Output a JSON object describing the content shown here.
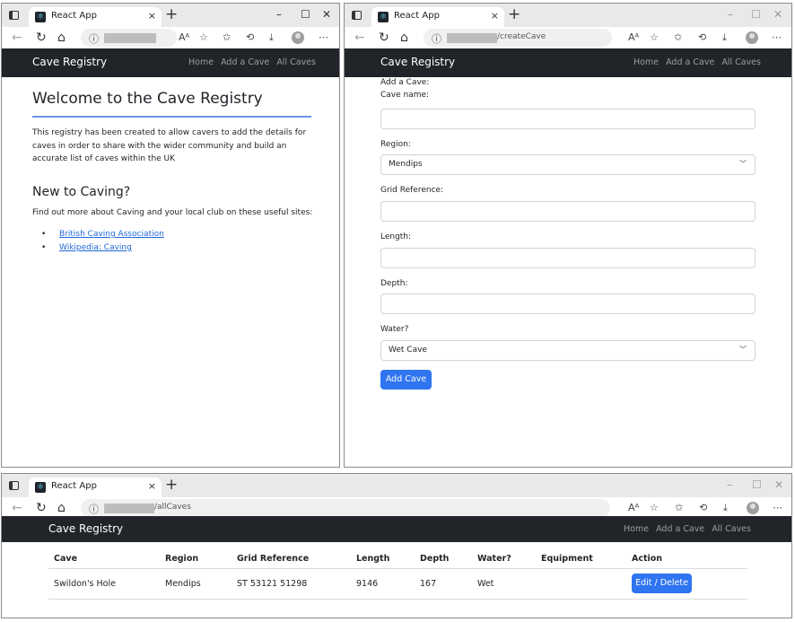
{
  "colors": {
    "navbar": "#212529",
    "primary": "#2f74f0",
    "link": "#1e67d8",
    "accent_rule": "#6b94e8"
  },
  "browser": {
    "tab_title": "React App",
    "tab_close": "×",
    "new_tab": "+",
    "window_controls": [
      "–",
      "☐",
      "✕"
    ],
    "read_aloud": "Aᴬ"
  },
  "windows": {
    "home": {
      "url_path": ""
    },
    "create": {
      "url_path": "/createCave"
    },
    "all": {
      "url_path": "/allCaves"
    }
  },
  "navbar": {
    "brand": "Cave Registry",
    "links": [
      "Home",
      "Add a Cave",
      "All Caves"
    ]
  },
  "home_page": {
    "title": "Welcome to the Cave Registry",
    "intro": "This registry has been created to allow cavers to add the details for caves in order to share with the wider community and build an accurate list of caves within the UK",
    "new_heading": "New to Caving?",
    "new_text": "Find out more about Caving and your local club on these useful sites:",
    "links": [
      "British Caving Association",
      "Wikipedia: Caving"
    ]
  },
  "create_page": {
    "form_title": "Add a Cave:",
    "cave_name_label": "Cave name:",
    "region_label": "Region:",
    "region_value": "Mendips",
    "grid_label": "Grid Reference:",
    "length_label": "Length:",
    "depth_label": "Depth:",
    "water_label": "Water?",
    "water_value": "Wet Cave",
    "submit": "Add Cave"
  },
  "all_page": {
    "headers": [
      "Cave",
      "Region",
      "Grid Reference",
      "Length",
      "Depth",
      "Water?",
      "Equipment",
      "Action"
    ],
    "rows": [
      {
        "cave": "Swildon's Hole",
        "region": "Mendips",
        "grid": "ST 53121 51298",
        "length": "9146",
        "depth": "167",
        "water": "Wet",
        "equipment": "",
        "action": "Edit / Delete"
      }
    ]
  }
}
